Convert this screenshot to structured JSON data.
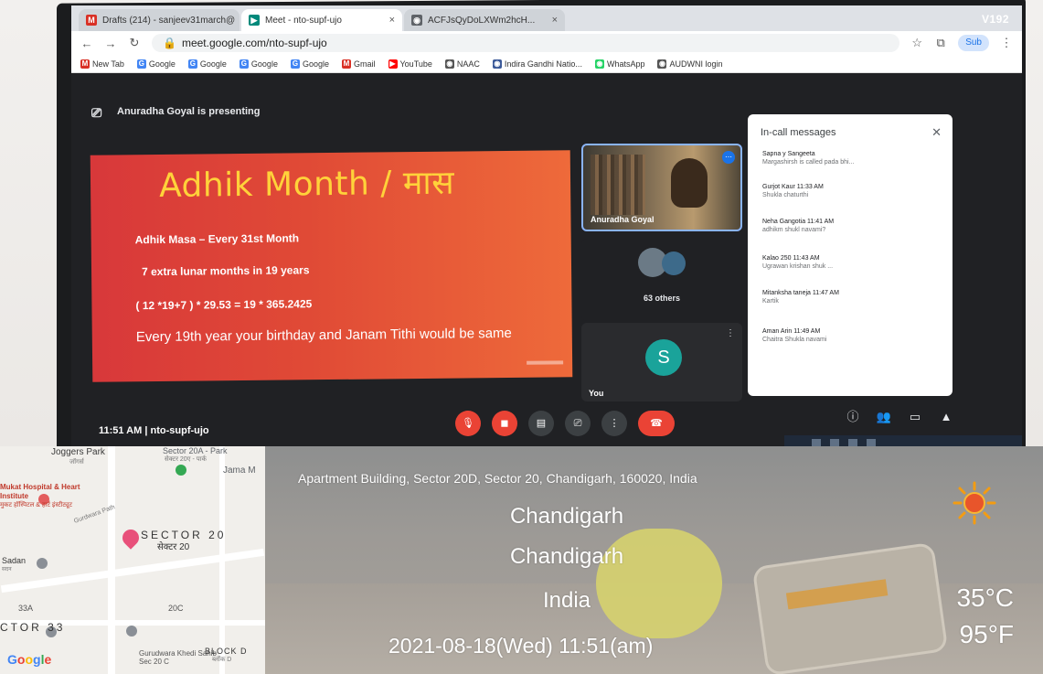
{
  "browser": {
    "tabs": [
      {
        "label": "Drafts (214) - sanjeev31march@",
        "favicon": "M",
        "favicon_color": "#d93025"
      },
      {
        "label": "Meet - nto-supf-ujo",
        "favicon": "▶",
        "favicon_color": "#00897b"
      },
      {
        "label": "ACFJsQyDoLXWm2hcH...",
        "favicon": "◉",
        "favicon_color": "#5f6368"
      }
    ],
    "tab_version": "V192",
    "url": "meet.google.com/nto-supf-ujo",
    "profile_label": "Sub",
    "bookmarks": [
      {
        "label": "New Tab",
        "icon": "M",
        "color": "#d93025"
      },
      {
        "label": "Google",
        "icon": "G",
        "color": "#4285f4"
      },
      {
        "label": "Google",
        "icon": "G",
        "color": "#4285f4"
      },
      {
        "label": "Google",
        "icon": "G",
        "color": "#4285f4"
      },
      {
        "label": "Google",
        "icon": "G",
        "color": "#4285f4"
      },
      {
        "label": "Gmail",
        "icon": "M",
        "color": "#d93025"
      },
      {
        "label": "YouTube",
        "icon": "▶",
        "color": "#ff0000"
      },
      {
        "label": "NAAC",
        "icon": "◉",
        "color": "#555555"
      },
      {
        "label": "Indira Gandhi Natio...",
        "icon": "◉",
        "color": "#3b5998"
      },
      {
        "label": "WhatsApp",
        "icon": "◉",
        "color": "#25d366"
      },
      {
        "label": "AUDWNI login",
        "icon": "◉",
        "color": "#555555"
      }
    ]
  },
  "meet": {
    "presenting_text": "Anuradha Goyal is presenting",
    "slide": {
      "title": "Adhik Month / मास",
      "line1": "Adhik Masa – Every 31st Month",
      "line2": "7 extra lunar months in 19 years",
      "line3": "( 12 *19+7 ) * 29.53  =  19 * 365.2425",
      "line4": "Every 19th year your birthday and Janam Tithi would be same"
    },
    "presenter_name": "Anuradha Goyal",
    "others_label": "63 others",
    "you_initial": "S",
    "you_label": "You",
    "chat": {
      "title": "In-call messages",
      "messages": [
        {
          "who": "Sapna y Sangeeta",
          "text": "Margashirsh is called pada bhi..."
        },
        {
          "who": "Gurjot Kaur  11:33 AM",
          "text": "Shukla chaturthi"
        },
        {
          "who": "Neha Gangotia  11:41 AM",
          "text": "adhikm shukl navami?"
        },
        {
          "who": "Kalao 250  11:43 AM",
          "text": "Ugrawan krishan shuk ..."
        },
        {
          "who": "Mitanksha taneja  11:47 AM",
          "text": "Kartik"
        },
        {
          "who": "Aman Arin  11:49 AM",
          "text": "Chaitra Shukla navami"
        }
      ]
    },
    "time": "11:51 AM",
    "meeting_code": "nto-supf-ujo",
    "colors": {
      "end_call": "#ea4335",
      "accent": "#8ab4f8"
    }
  },
  "map": {
    "labels": {
      "joggers": "Joggers Park",
      "joggers_hi": "जॉगर्स",
      "sector20a": "Sector 20A - Park",
      "sector20a_hi": "सेक्टर 20ए - पार्क",
      "jama": "Jama M",
      "mukat": "Mukat Hospital & Heart Institute",
      "mukat_hi": "मुकट हॉस्पिटल & हार्ट इंस्टीट्यूट",
      "road": "Gurdwara Path",
      "sector20": "SECTOR 20",
      "sector20_hi": "सेक्टर 20",
      "sadan": "Sadan",
      "sadan_hi": "सदन",
      "s33a": "33A",
      "s20c": "20C",
      "sector33": "CTOR 33",
      "gurudwara": "Gurudwara Khedi Sahib Sec 20 C",
      "block": "BLOCK D",
      "block_hi": "ब्लॉक D",
      "google": "Google"
    }
  },
  "overlay": {
    "address": "Apartment Building, Sector 20D, Sector 20, Chandigarh, 160020, India",
    "city": "Chandigarh",
    "state": "Chandigarh",
    "country": "India",
    "datetime": "2021-08-18(Wed)   11:51(am)",
    "temp_c": "35°C",
    "temp_f": "95°F",
    "weather_icon": "sun-icon"
  }
}
